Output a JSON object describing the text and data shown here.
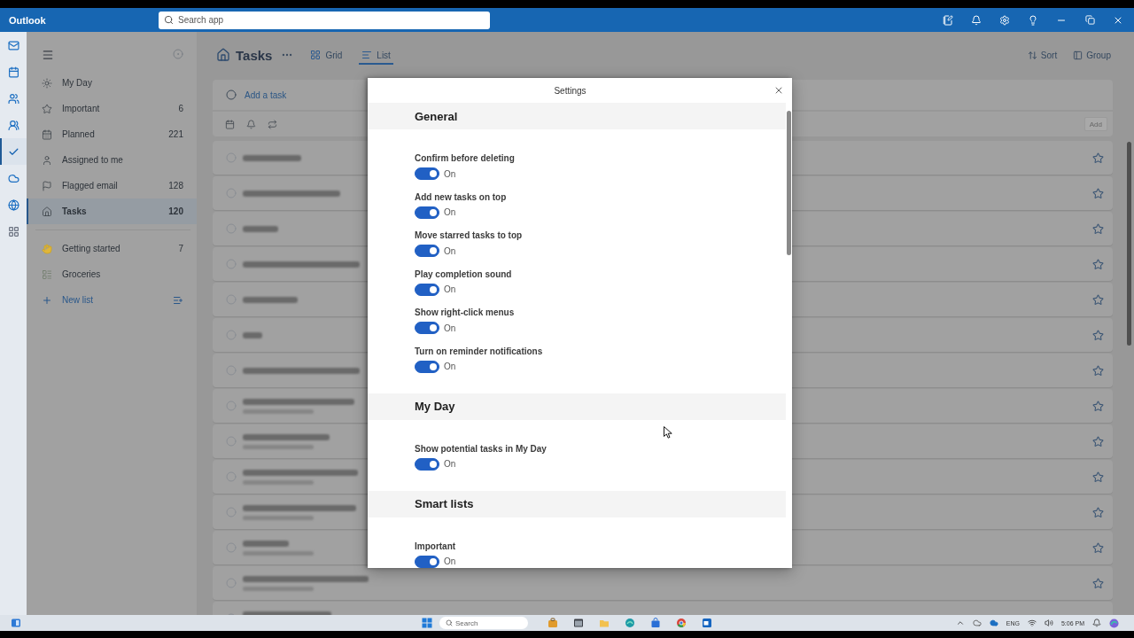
{
  "title_bar": {
    "app_name": "Outlook",
    "search": {
      "placeholder": "Search app"
    }
  },
  "app_rail": [
    {
      "selected": false
    },
    {
      "selected": false
    },
    {
      "selected": false
    },
    {
      "selected": false
    },
    {
      "selected": true
    },
    {
      "selected": false
    },
    {
      "selected": false
    },
    {
      "selected": false
    }
  ],
  "sidebar": {
    "items": [
      {
        "label": "My Day",
        "selected": false
      },
      {
        "label": "Important",
        "count": "6",
        "selected": false
      },
      {
        "label": "Planned",
        "count": "221",
        "selected": false
      },
      {
        "label": "Assigned to me",
        "selected": false
      },
      {
        "label": "Flagged email",
        "count": "128",
        "selected": false
      },
      {
        "label": "Tasks",
        "count": "120",
        "selected": true
      }
    ],
    "lists": [
      {
        "label": "Getting started",
        "count": "7",
        "selected": false
      },
      {
        "label": "Groceries",
        "selected": false
      }
    ],
    "new_list": {
      "label": "New list"
    }
  },
  "main": {
    "title": "Tasks",
    "views": [
      {
        "label": "Grid",
        "selected": false
      },
      {
        "label": "List",
        "selected": true
      }
    ],
    "actions": [
      {
        "label": "Sort"
      },
      {
        "label": "Group"
      }
    ],
    "add_task": {
      "placeholder": "Add a task",
      "button": "Add"
    },
    "tasks": [
      {
        "kind": "one-line",
        "starred": false
      },
      {
        "kind": "one-line",
        "starred": false
      },
      {
        "kind": "one-line",
        "starred": false
      },
      {
        "kind": "one-line",
        "starred": false
      },
      {
        "kind": "one-line",
        "starred": false
      },
      {
        "kind": "one-line",
        "starred": false
      },
      {
        "kind": "one-line",
        "starred": false
      },
      {
        "kind": "two-line",
        "starred": false
      },
      {
        "kind": "two-line",
        "starred": false
      },
      {
        "kind": "two-line",
        "starred": false
      },
      {
        "kind": "two-line",
        "starred": false
      },
      {
        "kind": "two-line",
        "starred": false
      },
      {
        "kind": "two-line",
        "starred": false
      },
      {
        "kind": "two-line"
      }
    ]
  },
  "settings_dialog": {
    "title": "Settings",
    "sections": [
      {
        "heading": "General",
        "options": [
          {
            "label": "Confirm before deleting",
            "on": true,
            "status": "On"
          },
          {
            "label": "Add new tasks on top",
            "on": true,
            "status": "On"
          },
          {
            "label": "Move starred tasks to top",
            "on": true,
            "status": "On"
          },
          {
            "label": "Play completion sound",
            "on": true,
            "status": "On"
          },
          {
            "label": "Show right-click menus",
            "on": true,
            "status": "On"
          },
          {
            "label": "Turn on reminder notifications",
            "on": true,
            "status": "On"
          }
        ]
      },
      {
        "heading": "My Day",
        "options": [
          {
            "label": "Show potential tasks in My Day",
            "on": true,
            "status": "On"
          }
        ]
      },
      {
        "heading": "Smart lists",
        "options": [
          {
            "label": "Important",
            "on": true,
            "status": "On"
          }
        ]
      }
    ]
  },
  "taskbar": {
    "search": {
      "placeholder": "Search"
    },
    "language": "ENG",
    "time": "5:06 PM"
  }
}
